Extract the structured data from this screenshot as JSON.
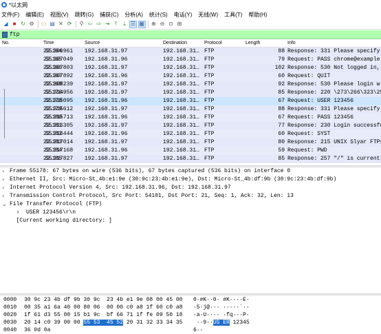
{
  "window": {
    "title": "*以太网"
  },
  "menu": [
    "文件(F)",
    "编辑(E)",
    "视图(V)",
    "跳转(G)",
    "捕获(C)",
    "分析(A)",
    "统计(S)",
    "电话(Y)",
    "无线(W)",
    "工具(T)",
    "帮助(H)"
  ],
  "toolbar": {
    "icons": [
      "shark-fin-icon",
      "stop-icon",
      "restart-icon",
      "options-gear-icon",
      "open-file-icon",
      "save-file-icon",
      "close-file-icon",
      "reload-icon",
      "find-icon",
      "go-back-icon",
      "go-forward-icon",
      "goto-packet-icon",
      "first-packet-icon",
      "last-packet-icon",
      "autoscroll-icon",
      "colorize-icon",
      "zoom-in-icon",
      "zoom-out-icon",
      "normal-size-icon",
      "resize-columns-icon"
    ]
  },
  "filter": {
    "value": "ftp"
  },
  "columns": {
    "no": "No.",
    "time": "Time",
    "source": "Source",
    "destination": "Destination",
    "protocol": "Protocol",
    "length": "Length",
    "info": "Info"
  },
  "packets": [
    {
      "no": "55164",
      "time": "22.306961",
      "source": "192.168.31.97",
      "destination": "192.168.31…",
      "protocol": "FTP",
      "length": "88",
      "info": "Response: 331 Please specify"
    },
    {
      "no": "55165",
      "time": "22.307049",
      "source": "192.168.31.96",
      "destination": "192.168.31…",
      "protocol": "FTP",
      "length": "79",
      "info": "Request: PASS chrome@example"
    },
    {
      "no": "55166",
      "time": "22.307803",
      "source": "192.168.31.97",
      "destination": "192.168.31…",
      "protocol": "FTP",
      "length": "102",
      "info": "Response: 530 Not logged in,"
    },
    {
      "no": "55167",
      "time": "22.307892",
      "source": "192.168.31.96",
      "destination": "192.168.31…",
      "protocol": "FTP",
      "length": "60",
      "info": "Request: QUIT"
    },
    {
      "no": "55168",
      "time": "22.308239",
      "source": "192.168.31.97",
      "destination": "192.168.31…",
      "protocol": "FTP",
      "length": "92",
      "info": "Response: 530 Please login w"
    },
    {
      "no": "55176",
      "time": "22.314956",
      "source": "192.168.31.97",
      "destination": "192.168.31…",
      "protocol": "FTP",
      "length": "85",
      "info": "Response: 220 \\273\\266\\323\\25"
    },
    {
      "no": "55178",
      "time": "22.315095",
      "source": "192.168.31.96",
      "destination": "192.168.31…",
      "protocol": "FTP",
      "length": "67",
      "info": "Request: USER 123456"
    },
    {
      "no": "55179",
      "time": "22.315612",
      "source": "192.168.31.97",
      "destination": "192.168.31…",
      "protocol": "FTP",
      "length": "88",
      "info": "Response: 331 Please specify"
    },
    {
      "no": "55180",
      "time": "22.315713",
      "source": "192.168.31.96",
      "destination": "192.168.31…",
      "protocol": "FTP",
      "length": "67",
      "info": "Request: PASS 123456"
    },
    {
      "no": "55181",
      "time": "22.316305",
      "source": "192.168.31.97",
      "destination": "192.168.31…",
      "protocol": "FTP",
      "length": "77",
      "info": "Response: 230 Login successfu"
    },
    {
      "no": "55182",
      "time": "22.316444",
      "source": "192.168.31.96",
      "destination": "192.168.31…",
      "protocol": "FTP",
      "length": "60",
      "info": "Request: SYST"
    },
    {
      "no": "55183",
      "time": "22.317014",
      "source": "192.168.31.97",
      "destination": "192.168.31…",
      "protocol": "FTP",
      "length": "80",
      "info": "Response: 215 UNIX Slyar FTPs"
    },
    {
      "no": "55184",
      "time": "22.317168",
      "source": "192.168.31.96",
      "destination": "192.168.31…",
      "protocol": "FTP",
      "length": "59",
      "info": "Request: PWD"
    },
    {
      "no": "55185",
      "time": "22.317827",
      "source": "192.168.31.97",
      "destination": "192.168.31…",
      "protocol": "FTP",
      "length": "85",
      "info": "Response: 257 \"/\" is current"
    }
  ],
  "details": [
    {
      "arrow": "›",
      "text": "Frame 55178: 67 bytes on wire (536 bits), 67 bytes captured (536 bits) on interface 0"
    },
    {
      "arrow": "›",
      "text": "Ethernet II, Src: Micro-St_4b:e1:9e (30:9c:23:4b:e1:9e), Dst: Micro-St_4b:df:9b (30:9c:23:4b:df:9b)"
    },
    {
      "arrow": "›",
      "text": "Internet Protocol Version 4, Src: 192.168.31.96, Dst: 192.168.31.97"
    },
    {
      "arrow": "›",
      "text": "Transmission Control Protocol, Src Port: 54101, Dst Port: 21, Seq: 1, Ack: 32, Len: 13"
    },
    {
      "arrow": "⌄",
      "text": "File Transfer Protocol (FTP)"
    },
    {
      "arrow": "",
      "text": "  ›  USER 123456\\r\\n"
    },
    {
      "arrow": "",
      "text": "  [Current working directory: ]"
    }
  ],
  "bytes": [
    {
      "offset": "0000",
      "hex_a": "30 9c 23 4b df 9b 30 9c  23 4b e1 9e 08 00 45 00",
      "hex_hl": "",
      "hex_b": "",
      "ascii_a": "0·#K··0· #K····E·",
      "ascii_hl": "",
      "ascii_b": ""
    },
    {
      "offset": "0010",
      "hex_a": "00 35 a1 6a 40 00 80 06  00 00 c0 a8 1f 60 c0 a8",
      "hex_hl": "",
      "hex_b": "",
      "ascii_a": "·5·j@··· ·····`··",
      "ascii_hl": "",
      "ascii_b": ""
    },
    {
      "offset": "0020",
      "hex_a": "1f 61 d3 55 00 15 b1 9c  bf 66 71 1f fe 09 50 18",
      "hex_hl": "",
      "hex_b": "",
      "ascii_a": "·a·U···· ·fq···P·",
      "ascii_hl": "",
      "ascii_b": ""
    },
    {
      "offset": "0030",
      "hex_a": "20 14 c0 39 00 00 ",
      "hex_hl": "55 53  45 52",
      "hex_b": " 20 31 32 33 34 35",
      "ascii_a": " ··9··",
      "ascii_hl": "US ER",
      "ascii_b": " 12345"
    },
    {
      "offset": "0040",
      "hex_a": "36 0d 0a",
      "hex_hl": "",
      "hex_b": "",
      "ascii_a": "6··",
      "ascii_hl": "",
      "ascii_b": ""
    }
  ],
  "selected_packet": "55178",
  "colors": {
    "filter_bg": "#afffaf",
    "row_ftp": "#e4e8f8",
    "row_selected": "#cce6ff",
    "byte_highlight": "#1f6fcf"
  }
}
